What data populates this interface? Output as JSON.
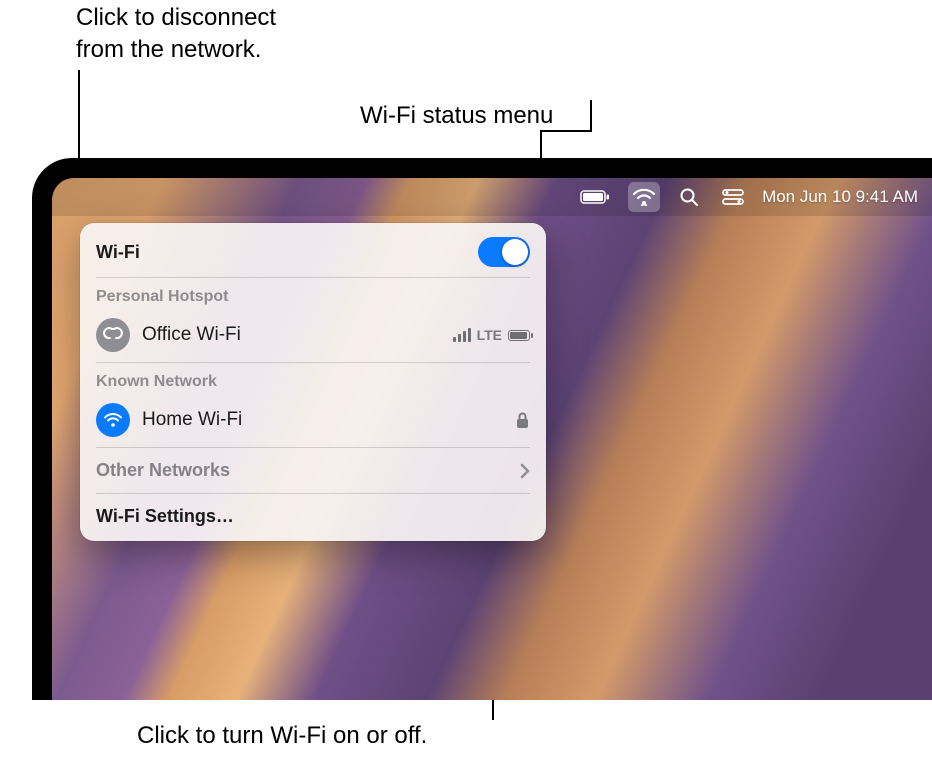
{
  "callouts": {
    "top_left": "Click to disconnect from the network.",
    "top_right": "Wi-Fi status menu",
    "bottom": "Click to turn Wi-Fi on or off."
  },
  "menubar": {
    "clock": "Mon Jun 10  9:41 AM"
  },
  "wifi_panel": {
    "title": "Wi-Fi",
    "toggle_on": true,
    "sections": {
      "hotspot": {
        "label": "Personal Hotspot",
        "network": {
          "name": "Office Wi-Fi",
          "carrier": "LTE"
        }
      },
      "known": {
        "label": "Known Network",
        "network": {
          "name": "Home Wi-Fi",
          "locked": true
        }
      }
    },
    "other_networks_label": "Other Networks",
    "settings_label": "Wi-Fi Settings…"
  }
}
